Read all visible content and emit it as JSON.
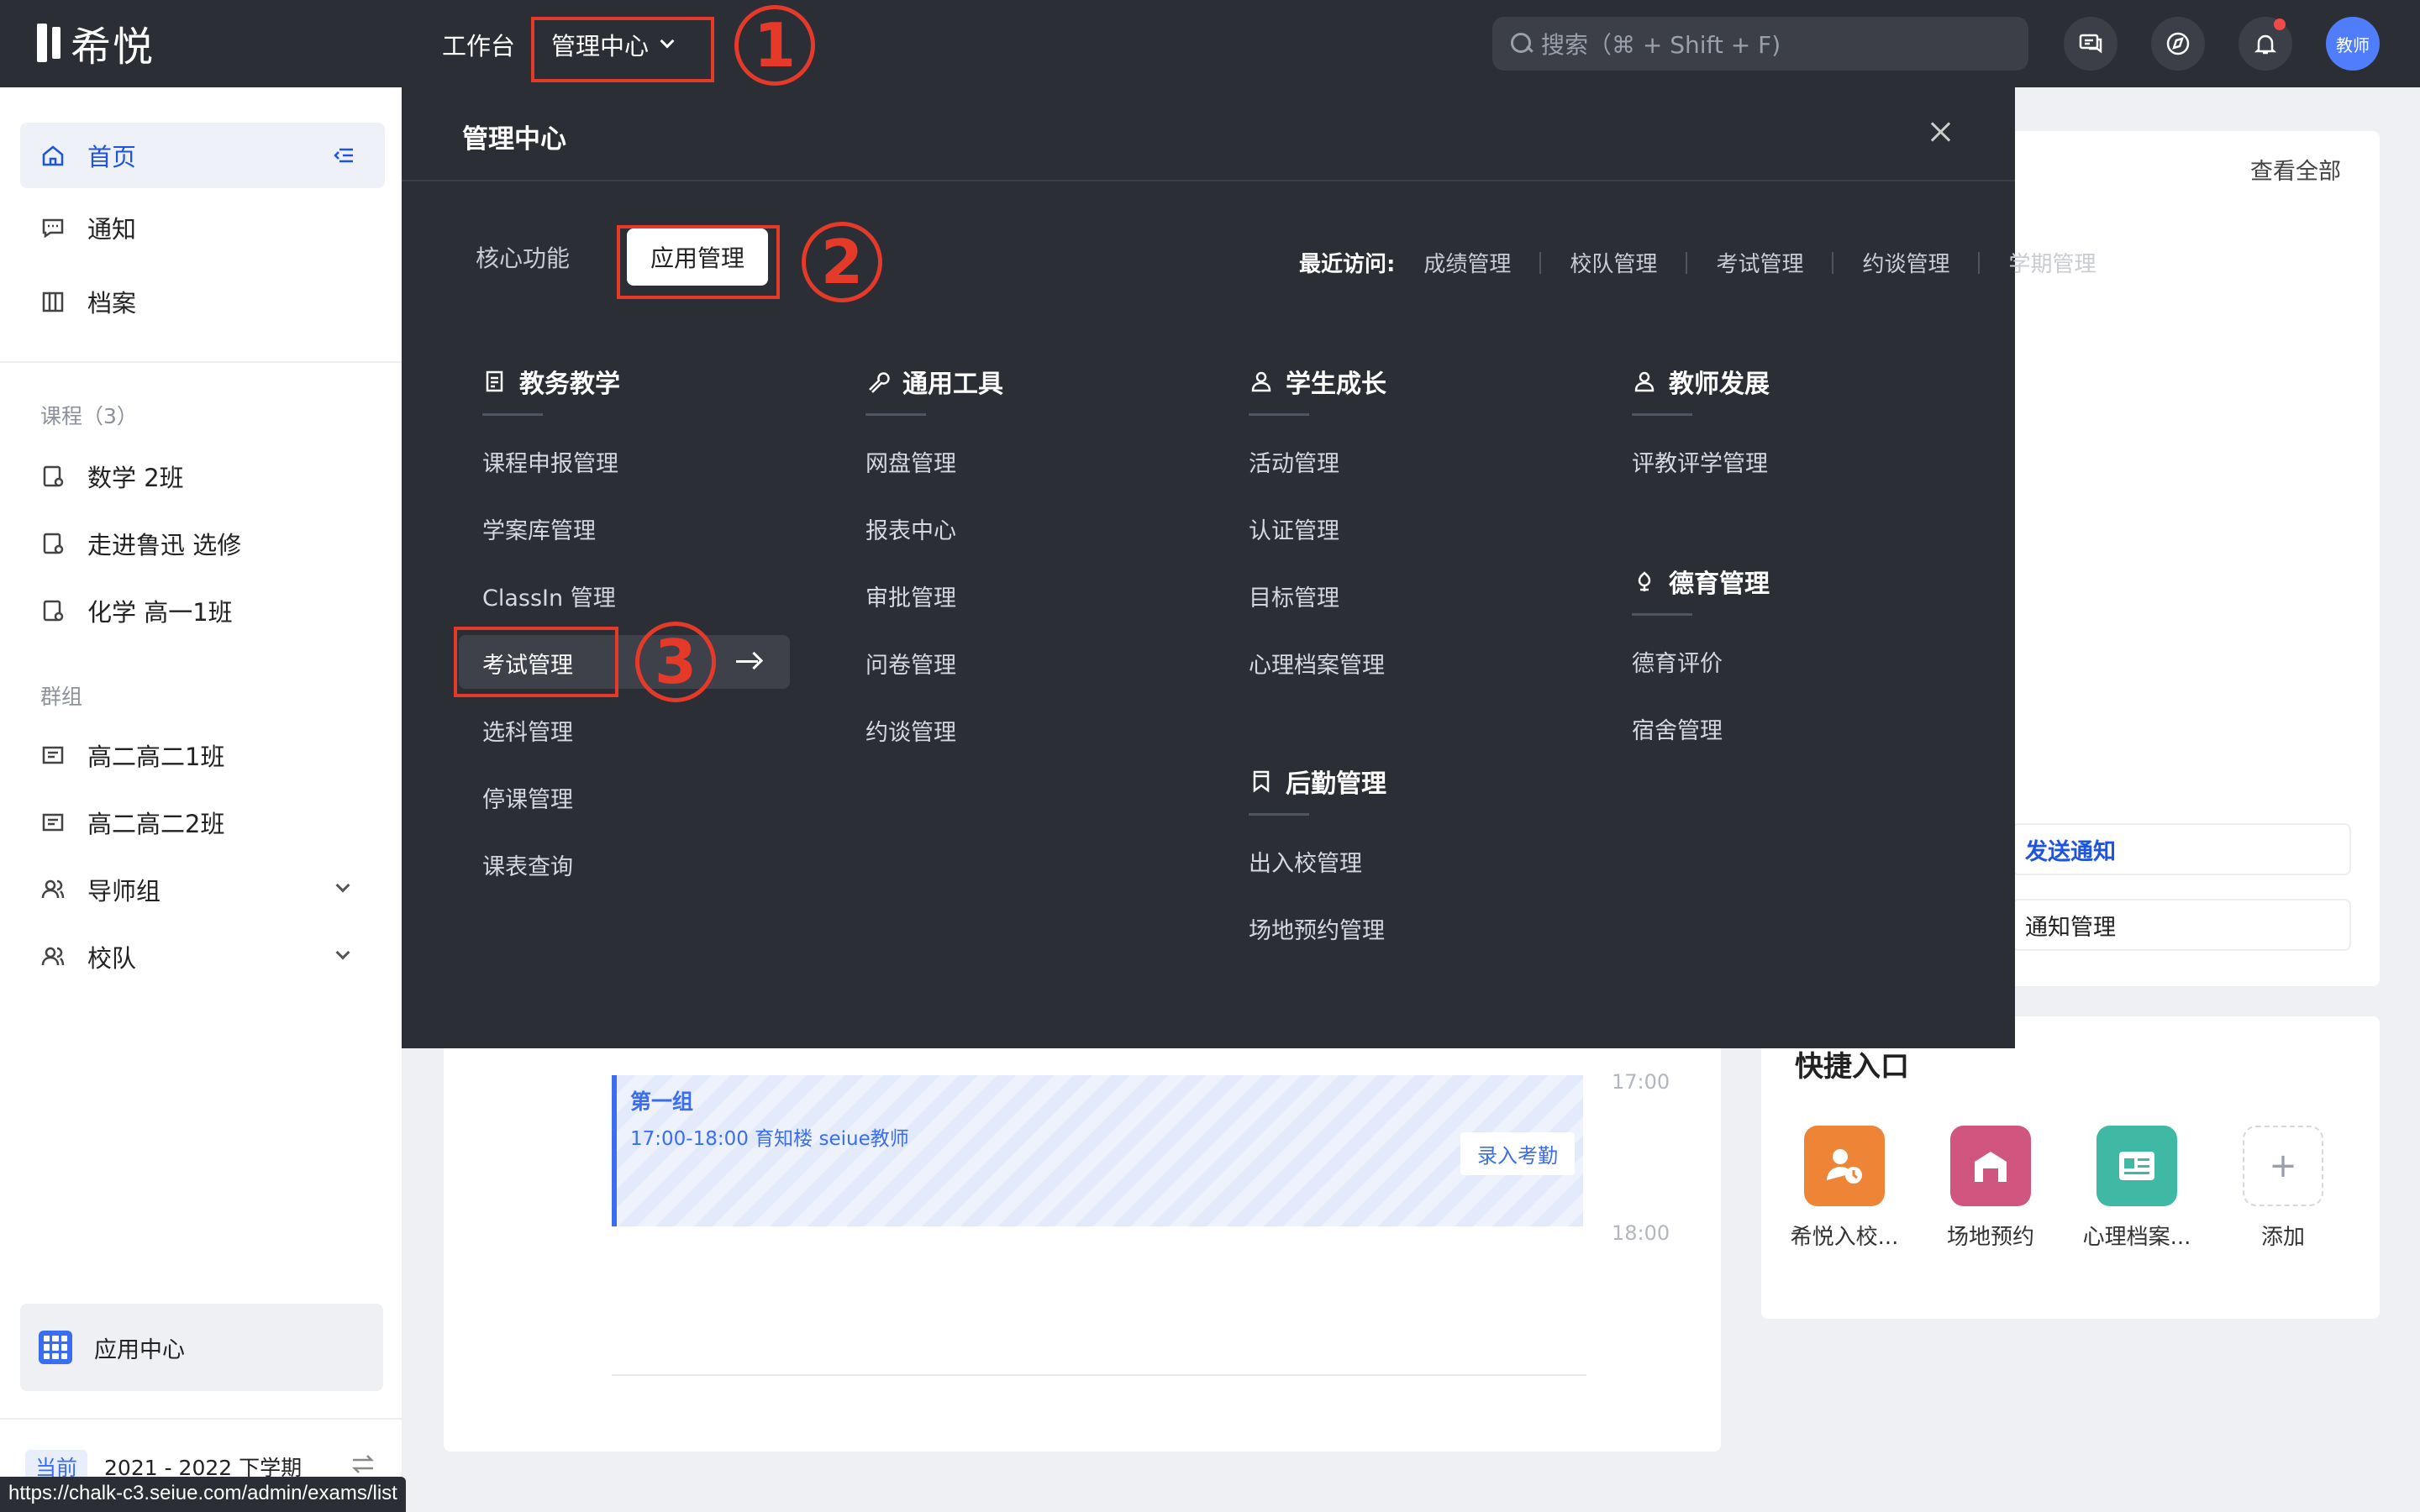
{
  "app": {
    "logo_text": "希悦",
    "nav_work": "工作台",
    "nav_mgmt": "管理中心",
    "search_placeholder": "搜索（⌘ + Shift + F)",
    "avatar_label": "教师"
  },
  "annotations": {
    "step1": "1",
    "step2": "2",
    "step3": "3",
    "color": "#e53a2a"
  },
  "sidebar": {
    "items": [
      {
        "label": "首页",
        "icon": "home-icon",
        "active": true
      },
      {
        "label": "通知",
        "icon": "message-icon"
      },
      {
        "label": "档案",
        "icon": "archive-icon"
      }
    ],
    "courses_heading": "课程（3）",
    "courses": [
      "数学 2班",
      "走进鲁迅 选修",
      "化学 高一1班"
    ],
    "groups_heading": "群组",
    "groups": [
      "高二高二1班",
      "高二高二2班",
      "导师组",
      "校队"
    ],
    "app_center": "应用中心",
    "term_badge": "当前",
    "term_label": "2021 - 2022 下学期"
  },
  "status_url": "https://chalk-c3.seiue.com/admin/exams/list",
  "panel": {
    "title": "管理中心",
    "tabs": [
      "核心功能",
      "应用管理"
    ],
    "active_tab": "应用管理",
    "recent_label": "最近访问:",
    "recent": [
      "成绩管理",
      "校队管理",
      "考试管理",
      "约谈管理",
      "学期管理"
    ],
    "categories": {
      "teaching": {
        "title": "教务教学",
        "items": [
          "课程申报管理",
          "学案库管理",
          "ClassIn 管理",
          "考试管理",
          "选科管理",
          "停课管理",
          "课表查询"
        ]
      },
      "tools": {
        "title": "通用工具",
        "items": [
          "网盘管理",
          "报表中心",
          "审批管理",
          "问卷管理",
          "约谈管理"
        ]
      },
      "growth": {
        "title": "学生成长",
        "items": [
          "活动管理",
          "认证管理",
          "目标管理",
          "心理档案管理"
        ]
      },
      "logistics": {
        "title": "后勤管理",
        "items": [
          "出入校管理",
          "场地预约管理"
        ]
      },
      "teacher": {
        "title": "教师发展",
        "items": [
          "评教评学管理"
        ]
      },
      "moral": {
        "title": "德育管理",
        "items": [
          "德育评价",
          "宿舍管理"
        ]
      }
    }
  },
  "calendar": {
    "event_title": "第一组",
    "event_meta": "17:00-18:00  育知楼  seiue教师",
    "event_button": "录入考勤",
    "time_1700": "17:00",
    "time_1800": "18:00"
  },
  "right": {
    "view_all": "查看全部",
    "send_notice": "发送通知",
    "notice_mgmt": "通知管理",
    "quick_title": "快捷入口",
    "quick_items": [
      {
        "label": "希悦入校...",
        "color": "#ee8435",
        "icon": "person-clock-icon"
      },
      {
        "label": "场地预约",
        "color": "#d0557f",
        "icon": "building-icon"
      },
      {
        "label": "心理档案...",
        "color": "#3fb9a4",
        "icon": "id-card-icon"
      },
      {
        "label": "添加",
        "icon": "plus-icon"
      }
    ]
  }
}
